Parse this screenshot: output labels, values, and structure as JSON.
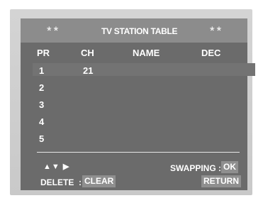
{
  "header": {
    "left_stars": "**",
    "title": "TV STATION TABLE",
    "right_stars": "**"
  },
  "columns": [
    "PR",
    "CH",
    "NAME",
    "DEC"
  ],
  "rows": [
    {
      "pr": "1",
      "ch": "21",
      "name": "",
      "dec": ""
    },
    {
      "pr": "2",
      "ch": "",
      "name": "",
      "dec": ""
    },
    {
      "pr": "3",
      "ch": "",
      "name": "",
      "dec": ""
    },
    {
      "pr": "4",
      "ch": "",
      "name": "",
      "dec": ""
    },
    {
      "pr": "5",
      "ch": "",
      "name": "",
      "dec": ""
    }
  ],
  "selected_row": 1,
  "footer": {
    "nav_arrows": "▲▼ ▶",
    "swapping_label": "SWAPPING :",
    "swapping_key": "OK",
    "delete_label": "DELETE  :",
    "delete_key": "CLEAR",
    "return_key": "RETURN"
  },
  "colors": {
    "screen_bg": "#6b6b6b",
    "title_bar_bg": "#8c8c8c",
    "key_bg": "#8f8f8f",
    "text": "#ffffff"
  }
}
